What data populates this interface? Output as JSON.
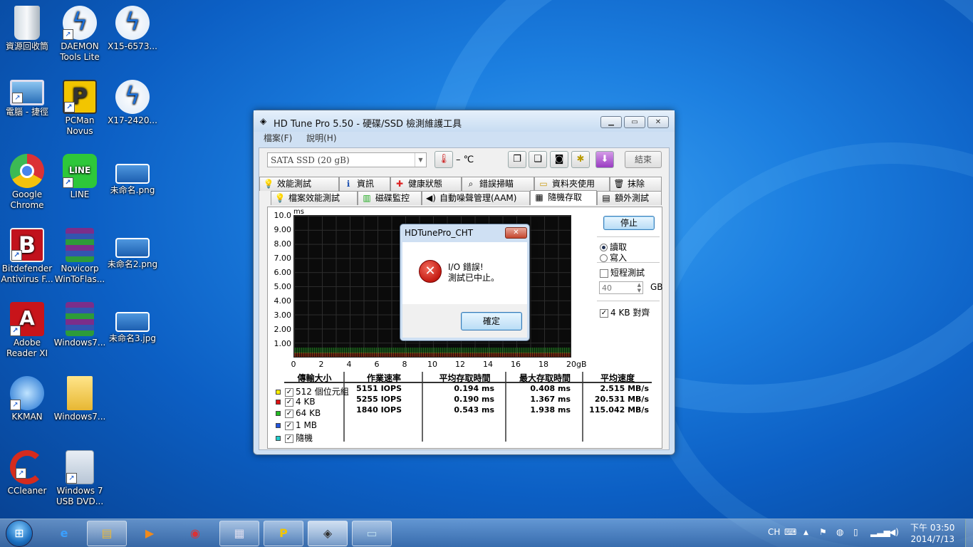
{
  "desktop": {
    "icons": [
      {
        "label": "資源回收筒",
        "icon": "recycle-bin-icon"
      },
      {
        "label": "DAEMON Tools Lite",
        "icon": "daemon-tools-icon"
      },
      {
        "label": "X15-6573...",
        "icon": "daemon-image-icon"
      },
      {
        "label": "電腦 - 捷徑",
        "icon": "computer-icon"
      },
      {
        "label": "PCMan Novus",
        "icon": "pcman-icon"
      },
      {
        "label": "X17-2420...",
        "icon": "daemon-image-icon"
      },
      {
        "label": "Google Chrome",
        "icon": "chrome-icon"
      },
      {
        "label": "LINE",
        "icon": "line-icon"
      },
      {
        "label": "未命名.png",
        "icon": "image-file-icon"
      },
      {
        "label": "Bitdefender Antivirus F...",
        "icon": "bitdefender-icon"
      },
      {
        "label": "Novicorp WinToFlas...",
        "icon": "winrar-icon"
      },
      {
        "label": "未命名2.png",
        "icon": "image-file-icon"
      },
      {
        "label": "Adobe Reader XI",
        "icon": "adobe-reader-icon"
      },
      {
        "label": "Windows7...",
        "icon": "winrar-icon"
      },
      {
        "label": "未命名3.jpg",
        "icon": "image-file-icon"
      },
      {
        "label": "KKMAN",
        "icon": "kkman-icon"
      },
      {
        "label": "Windows7...",
        "icon": "folder-icon"
      },
      {
        "label": "CCleaner",
        "icon": "ccleaner-icon"
      },
      {
        "label": "Windows 7 USB DVD...",
        "icon": "usb-dvd-tool-icon"
      }
    ]
  },
  "window": {
    "title": "HD Tune Pro 5.50 - 硬碟/SSD 檢測維護工具",
    "menu": [
      "檔案(F)",
      "說明(H)"
    ],
    "drive": "SATA SSD (20 gB)",
    "temp": "– ℃",
    "end_button": "結束",
    "tabs_row1": [
      "效能測試",
      "資訊",
      "健康狀態",
      "錯誤掃瞄",
      "資料夾使用",
      "抹除"
    ],
    "tabs_row2": [
      "檔案效能測試",
      "磁碟監控",
      "自動噪聲管理(AAM)",
      "隨機存取",
      "額外測試"
    ],
    "stop_button": "停止",
    "read_label": "讀取",
    "write_label": "寫入",
    "short_test_label": "短程測試",
    "short_test_value": "40",
    "short_test_unit": "GB",
    "align_label": "4 KB 對齊"
  },
  "chart_data": {
    "type": "scatter",
    "ylabel": "ms",
    "y_ticks": [
      "10.0",
      "9.00",
      "8.00",
      "7.00",
      "6.00",
      "5.00",
      "4.00",
      "3.00",
      "2.00",
      "1.00"
    ],
    "x_ticks": [
      "0",
      "2",
      "4",
      "6",
      "8",
      "10",
      "12",
      "14",
      "16",
      "18",
      "20gB"
    ],
    "ylim": [
      0,
      10
    ],
    "xlim": [
      0,
      20
    ],
    "series": [
      {
        "name": "512 個位元組",
        "color": "#e6d800",
        "approx_ms": 0.194
      },
      {
        "name": "4 KB",
        "color": "#d21a1a",
        "approx_ms": 0.19
      },
      {
        "name": "64 KB",
        "color": "#2bc02b",
        "approx_ms": 0.543
      }
    ]
  },
  "results": {
    "headers": [
      "傳輸大小",
      "作業速率",
      "平均存取時間",
      "最大存取時間",
      "平均速度"
    ],
    "rows": [
      {
        "label": "512 個位元組",
        "color": "#ffee00",
        "iops": "5151 IOPS",
        "avg": "0.194 ms",
        "max": "0.408 ms",
        "speed": "2.515 MB/s"
      },
      {
        "label": "4 KB",
        "color": "#dd1111",
        "iops": "5255 IOPS",
        "avg": "0.190 ms",
        "max": "1.367 ms",
        "speed": "20.531 MB/s"
      },
      {
        "label": "64 KB",
        "color": "#22bb22",
        "iops": "1840 IOPS",
        "avg": "0.543 ms",
        "max": "1.938 ms",
        "speed": "115.042 MB/s"
      },
      {
        "label": "1 MB",
        "color": "#2255dd",
        "iops": "",
        "avg": "",
        "max": "",
        "speed": ""
      },
      {
        "label": "隨機",
        "color": "#22cccc",
        "iops": "",
        "avg": "",
        "max": "",
        "speed": ""
      }
    ]
  },
  "dialog": {
    "title": "HDTunePro_CHT",
    "line1": "I/O 錯誤!",
    "line2": "測試已中止。",
    "ok": "確定"
  },
  "tray": {
    "lang": "CH",
    "time": "下午 03:50",
    "date": "2014/7/13"
  }
}
